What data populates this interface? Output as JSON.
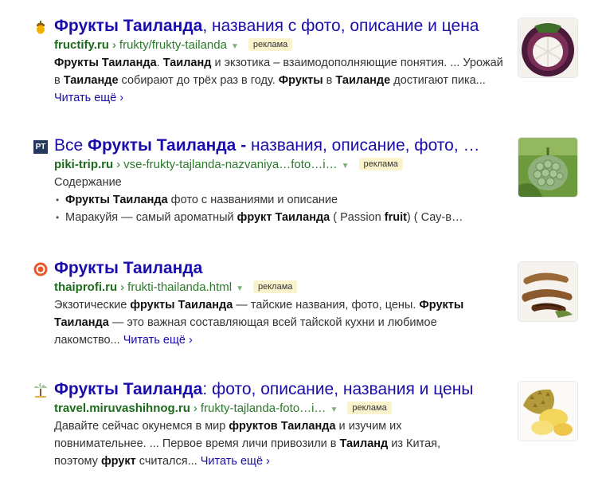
{
  "results": [
    {
      "icon": "acorn-icon",
      "title_bold": "Фрукты Таиланда",
      "title_rest": ", названия с фото, описание и цена",
      "domain": "fructify.ru",
      "separator": "›",
      "path": "frukty/frukty-tailanda",
      "ad_label": "реклама",
      "snippet": {
        "s1": "Фрукты Таиланда",
        "s2": ". ",
        "s3": "Таиланд",
        "s4": " и экзотика – взаимодополняющие понятия. ... Урожай в ",
        "s5": "Таиланде",
        "s6": " собирают до трёх раз в году. ",
        "s7": "Фрукты",
        "s8": " в ",
        "s9": "Таиланде",
        "s10": " достигают пика..."
      },
      "more": "Читать ещё ›",
      "thumb": "mangosteen-thumbnail"
    },
    {
      "icon": "pt-logo-icon",
      "icon_text": "PT",
      "title_pre": "Все ",
      "title_bold": "Фрукты Таиланда -",
      "title_rest": " названия, описание, фото, …",
      "domain": "piki-trip.ru",
      "separator": "›",
      "path": "vse-frukty-tajlanda-nazvaniya…foto…i…",
      "ad_label": "реклама",
      "contents_label": "Содержание",
      "items": [
        {
          "bold": "Фрукты Таиланда",
          "rest": " фото с названиями и описание"
        },
        {
          "a": "Маракуйя — самый ароматный ",
          "b": "фрукт Таиланда",
          "c": " ( Passion ",
          "d": "fruit",
          "e": ") ( Сау-в…"
        }
      ],
      "thumb": "custard-apple-thumbnail"
    },
    {
      "icon": "thaiprofi-logo-icon",
      "title_bold": "Фрукты Таиланда",
      "domain": "thaiprofi.ru",
      "separator": "›",
      "path": "frukti-thailanda.html",
      "ad_label": "реклама",
      "snippet": {
        "s1": "Экзотические ",
        "s2": "фрукты Таиланда",
        "s3": " — тайские названия, фото, цены. ",
        "s4": "Фрукты Таиланда",
        "s5": " — это важная составляющая всей тайской кухни и любимое лакомство..."
      },
      "more": "Читать ещё ›",
      "thumb": "tamarind-thumbnail"
    },
    {
      "icon": "palm-icon",
      "title_bold": "Фрукты Таиланда",
      "title_rest": ": фото, описание, названия и цены",
      "domain": "travel.miruvashihnog.ru",
      "separator": "›",
      "path": "frukty-tajlanda-foto…i…",
      "ad_label": "реклама",
      "snippet": {
        "s1": "Давайте сейчас окунемся в мир ",
        "s2": "фруктов Таиланда",
        "s3": " и изучим их повнимательнее. ... Первое время личи привозили в ",
        "s4": "Таиланд",
        "s5": " из Китая, поэтому ",
        "s6": "фрукт",
        "s7": " считался..."
      },
      "more": "Читать ещё ›",
      "thumb": "durian-thumbnail"
    }
  ],
  "colors": {
    "title": "#1a0dab",
    "url": "#2a7a2a",
    "ad_bg": "#fbf3cc"
  }
}
